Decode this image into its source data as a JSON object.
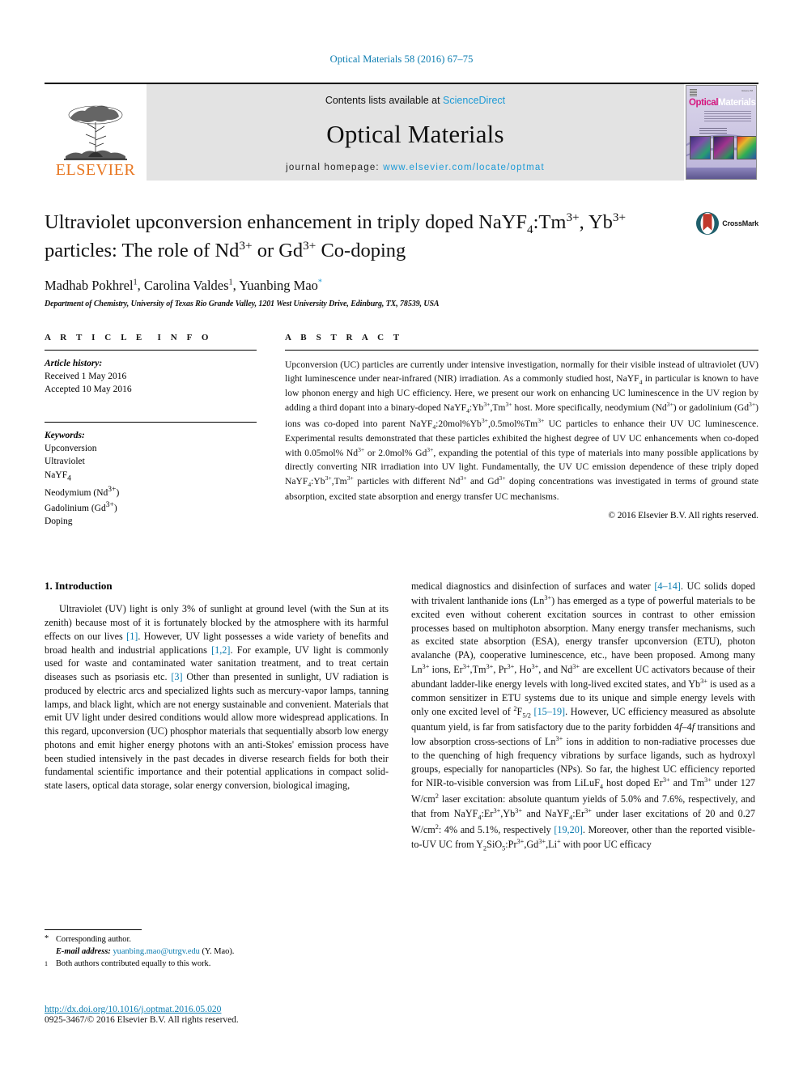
{
  "running_head": "Optical Materials 58 (2016) 67–75",
  "masthead": {
    "elsevier_wordmark": "ELSEVIER",
    "contents_prefix": "Contents lists available at ",
    "sciencedirect": "ScienceDirect",
    "journal_name": "Optical Materials",
    "homepage_prefix": "journal homepage: ",
    "homepage_url": "www.elsevier.com/locate/optmat",
    "cover": {
      "title_part1": "Optical",
      "title_part2": "Materials",
      "issue_note": "Volume 58"
    },
    "colors": {
      "elsevier_orange": "#e87722",
      "link_blue": "#1c9ad6",
      "band_gray": "#e3e3e3"
    }
  },
  "article": {
    "title_line1_a": "Ultraviolet upconversion enhancement in triply doped NaYF",
    "title_line1_sub": "4",
    "title_line1_b": ":Tm",
    "title_line1_sup": "3+",
    "title_line1_c": ",",
    "title_line2_a": "Yb",
    "title_line2_sup": "3+",
    "title_line2_b": " particles: The role of Nd",
    "title_line2_sup2": "3+",
    "title_line2_c": " or Gd",
    "title_line2_sup3": "3+",
    "title_line2_d": " Co-doping",
    "crossmark_label": "CrossMark",
    "authors": [
      {
        "name": "Madhab Pokhrel",
        "mark": "1"
      },
      {
        "name": "Carolina Valdes",
        "mark": "1"
      },
      {
        "name": "Yuanbing Mao",
        "mark": "*"
      }
    ],
    "authors_plain": "Madhab Pokhrel 1, Carolina Valdes 1, Yuanbing Mao*",
    "affiliation": "Department of Chemistry, University of Texas Rio Grande Valley, 1201 West University Drive, Edinburg, TX, 78539, USA"
  },
  "article_info": {
    "heading": "ARTICLE INFO",
    "history_label": "Article history:",
    "history": [
      "Received 1 May 2016",
      "Accepted 10 May 2016"
    ],
    "keywords_label": "Keywords:",
    "keywords": [
      "Upconversion",
      "Ultraviolet",
      "NaYF4",
      "Neodymium (Nd3+)",
      "Gadolinium (Gd3+)",
      "Doping"
    ]
  },
  "abstract": {
    "heading": "ABSTRACT",
    "text": "Upconversion (UC) particles are currently under intensive investigation, normally for their visible instead of ultraviolet (UV) light luminescence under near-infrared (NIR) irradiation. As a commonly studied host, NaYF4 in particular is known to have low phonon energy and high UC efficiency. Here, we present our work on enhancing UC luminescence in the UV region by adding a third dopant into a binary-doped NaYF4:Yb3+,Tm3+ host. More specifically, neodymium (Nd3+) or gadolinium (Gd3+) ions was co-doped into parent NaYF4:20mol%Yb3+,0.5mol%Tm3+ UC particles to enhance their UV UC luminescence. Experimental results demonstrated that these particles exhibited the highest degree of UV UC enhancements when co-doped with 0.05mol% Nd3+ or 2.0mol% Gd3+, expanding the potential of this type of materials into many possible applications by directly converting NIR irradiation into UV light. Fundamentally, the UV UC emission dependence of these triply doped NaYF4:Yb3+,Tm3+ particles with different Nd3+ and Gd3+ doping concentrations was investigated in terms of ground state absorption, excited state absorption and energy transfer UC mechanisms.",
    "copyright": "© 2016 Elsevier B.V. All rights reserved."
  },
  "introduction": {
    "section_number": "1.",
    "section_title": "Introduction",
    "left_column": "Ultraviolet (UV) light is only 3% of sunlight at ground level (with the Sun at its zenith) because most of it is fortunately blocked by the atmosphere with its harmful effects on our lives [1]. However, UV light possesses a wide variety of benefits and broad health and industrial applications [1,2]. For example, UV light is commonly used for waste and contaminated water sanitation treatment, and to treat certain diseases such as psoriasis etc. [3] Other than presented in sunlight, UV radiation is produced by electric arcs and specialized lights such as mercury-vapor lamps, tanning lamps, and black light, which are not energy sustainable and convenient. Materials that emit UV light under desired conditions would allow more widespread applications. In this regard, upconversion (UC) phosphor materials that sequentially absorb low energy photons and emit higher energy photons with an anti-Stokes' emission process have been studied intensively in the past decades in diverse research fields for both their fundamental scientific importance and their potential applications in compact solid-state lasers, optical data storage, solar energy conversion, biological imaging,",
    "right_column": "medical diagnostics and disinfection of surfaces and water [4–14]. UC solids doped with trivalent lanthanide ions (Ln3+) has emerged as a type of powerful materials to be excited even without coherent excitation sources in contrast to other emission processes based on multiphoton absorption. Many energy transfer mechanisms, such as excited state absorption (ESA), energy transfer upconversion (ETU), photon avalanche (PA), cooperative luminescence, etc., have been proposed. Among many Ln3+ ions, Er3+,Tm3+, Pr3+, Ho3+, and Nd3+ are excellent UC activators because of their abundant ladder-like energy levels with long-lived excited states, and Yb3+ is used as a common sensitizer in ETU systems due to its unique and simple energy levels with only one excited level of 2F5/2 [15–19]. However, UC efficiency measured as absolute quantum yield, is far from satisfactory due to the parity forbidden 4f–4f transitions and low absorption cross-sections of Ln3+ ions in addition to non-radiative processes due to the quenching of high frequency vibrations by surface ligands, such as hydroxyl groups, especially for nanoparticles (NPs). So far, the highest UC efficiency reported for NIR-to-visible conversion was from LiLuF4 host doped Er3+ and Tm3+ under 127 W/cm2 laser excitation: absolute quantum yields of 5.0% and 7.6%, respectively, and that from NaYF4:Er3+,Yb3+ and NaYF4:Er3+ under laser excitations of 20 and 0.27 W/cm2: 4% and 5.1%, respectively [19,20]. Moreover, other than the reported visible-to-UV UC from Y2SiO5:Pr3+,Gd3+,Li+ with poor UC efficacy",
    "citations": [
      "[1]",
      "[1,2]",
      "[3]",
      "[4–14]",
      "[15–19]",
      "[19,20]"
    ]
  },
  "footnotes": {
    "corresponding_marker": "*",
    "corresponding_text": "Corresponding author.",
    "email_label": "E-mail address:",
    "email": "yuanbing.mao@utrgv.edu",
    "email_suffix": "(Y. Mao).",
    "equal_marker": "1",
    "equal_text": "Both authors contributed equally to this work."
  },
  "footer": {
    "doi": "http://dx.doi.org/10.1016/j.optmat.2016.05.020",
    "issn_line": "0925-3467/© 2016 Elsevier B.V. All rights reserved."
  }
}
